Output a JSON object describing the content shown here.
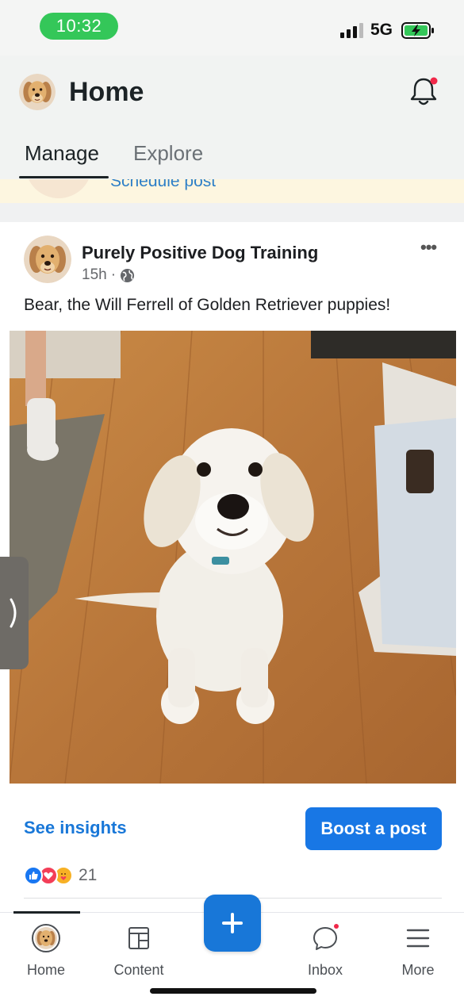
{
  "status_bar": {
    "time": "10:32",
    "network": "5G",
    "signal_icon": "cellular-signal-icon",
    "battery_icon": "battery-charging-icon",
    "time_pill_color": "#34c759"
  },
  "header": {
    "title": "Home",
    "avatar_icon": "golden-retriever-avatar",
    "notification_icon": "bell-icon",
    "notification_dot_color": "#f02849",
    "tabs": [
      {
        "label": "Manage",
        "active": true
      },
      {
        "label": "Explore",
        "active": false
      }
    ]
  },
  "schedule_strip": {
    "link_label": "Schedule post"
  },
  "post": {
    "author": "Purely Positive Dog Training",
    "time": "15h",
    "separator": "·",
    "audience_icon": "globe-icon",
    "more_icon": "more-dots-icon",
    "more_label": "•••",
    "text": "Bear, the Will Ferrell of Golden Retriever puppies!",
    "image_icon": "golden-retriever-puppy-photo",
    "insights_label": "See insights",
    "boost_label": "Boost a post",
    "reaction_icons": [
      "like-icon",
      "love-icon",
      "care-icon"
    ],
    "reaction_count": "21"
  },
  "side_handle": {
    "icon": "chevron-right-icon",
    "glyph": "❭"
  },
  "bottom_nav": {
    "items": [
      {
        "label": "Home",
        "icon": "profile-avatar-icon",
        "active": true
      },
      {
        "label": "Content",
        "icon": "content-icon",
        "active": false
      },
      {
        "label": "Inbox",
        "icon": "chat-bubble-icon",
        "active": false
      },
      {
        "label": "More",
        "icon": "hamburger-menu-icon",
        "active": false
      }
    ],
    "fab_icon": "plus-icon",
    "fab_glyph": "+",
    "accent_color": "#1877d8"
  }
}
